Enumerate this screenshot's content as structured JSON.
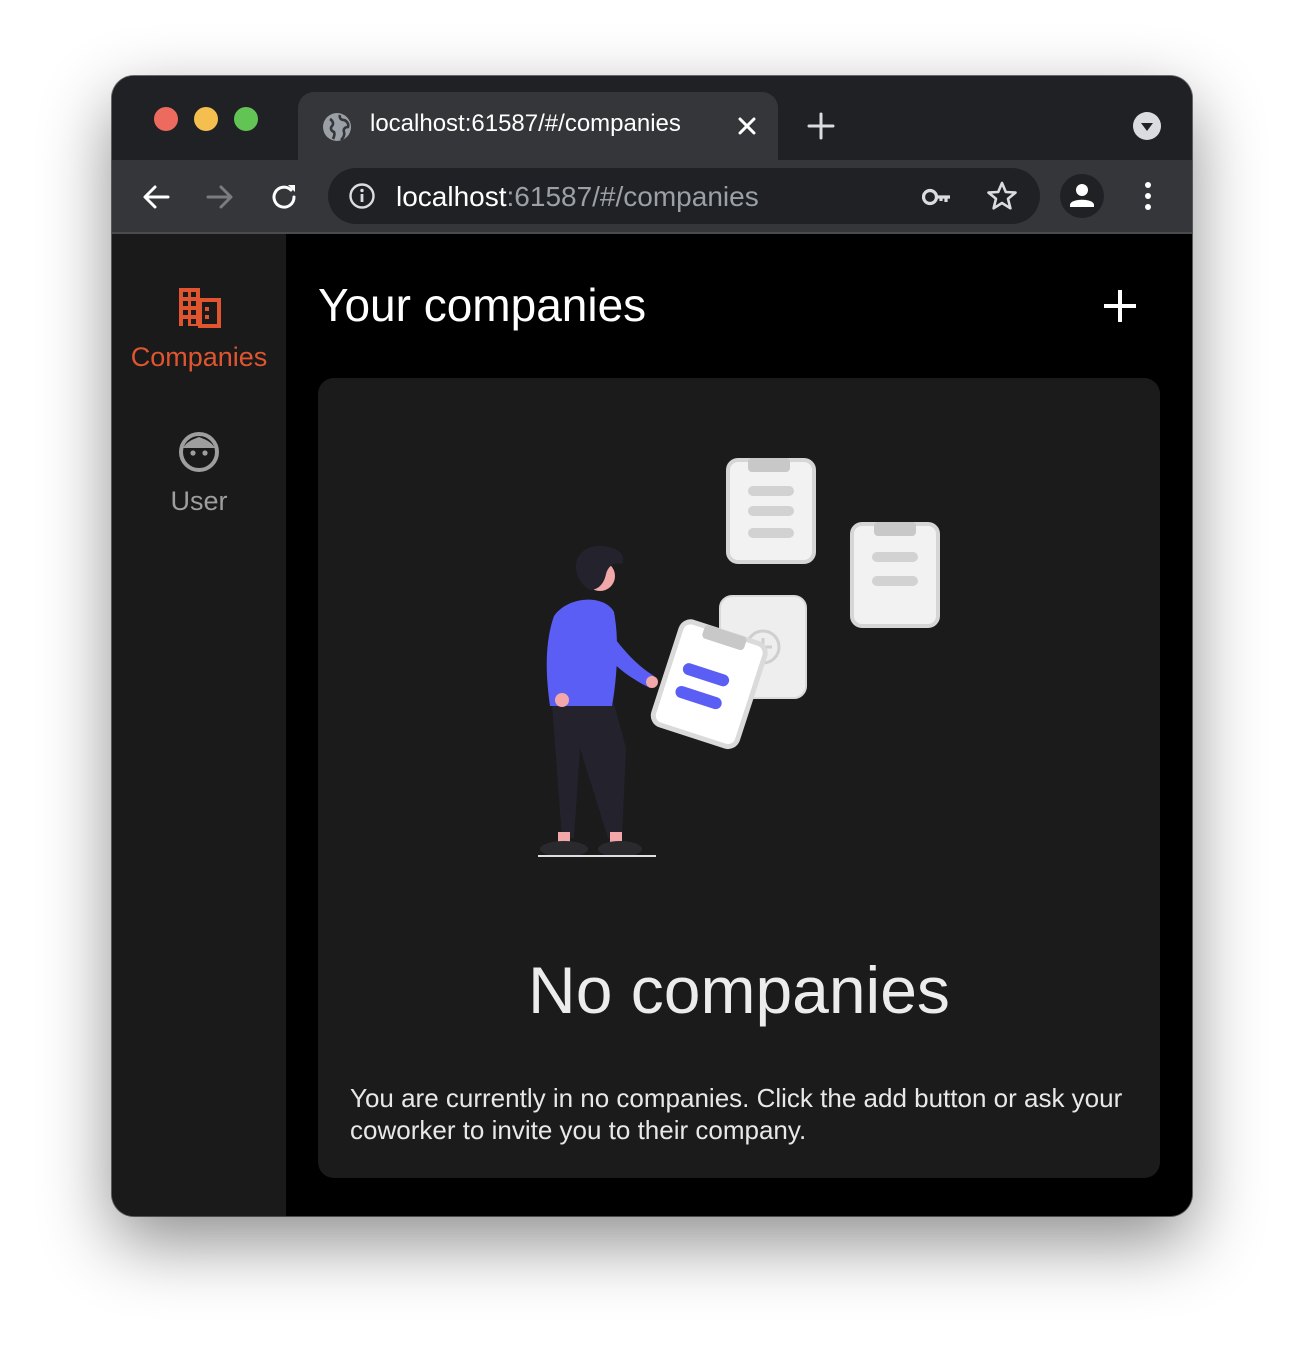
{
  "browser": {
    "tab_title": "localhost:61587/#/companies",
    "url_host": "localhost",
    "url_rest": ":61587/#/companies"
  },
  "sidebar": {
    "items": [
      {
        "label": "Companies",
        "icon": "building-icon",
        "active": true,
        "color": "#e0552f"
      },
      {
        "label": "User",
        "icon": "face-icon",
        "active": false,
        "color": "#9e9e9e"
      }
    ]
  },
  "main": {
    "title": "Your companies",
    "empty_state": {
      "title": "No companies",
      "description": "You are currently in no companies. Click the add button or ask your coworker to invite you to their company."
    }
  },
  "colors": {
    "accent": "#e0552f",
    "illustration_accent": "#5b5ef4",
    "background": "#000000",
    "card": "#1b1b1c",
    "sidebar": "#1a1a1a"
  }
}
